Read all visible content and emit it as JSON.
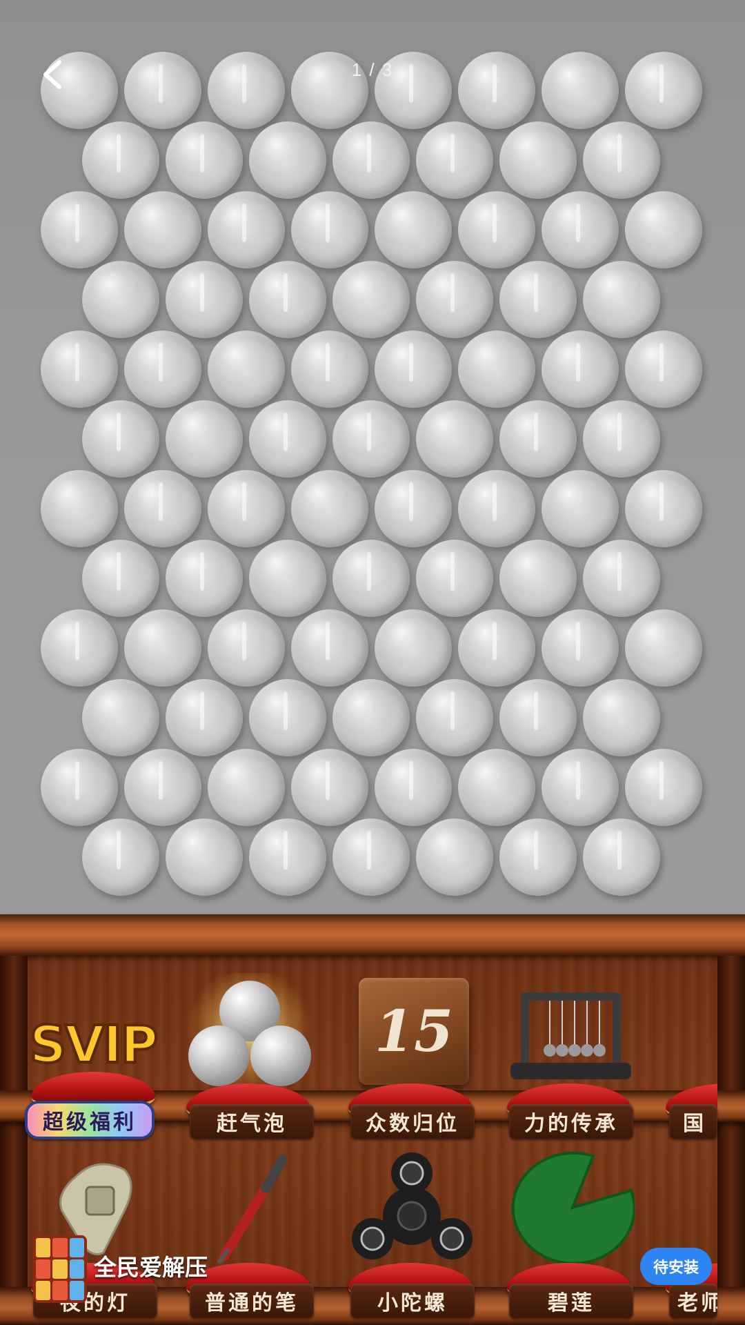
{
  "header": {
    "back_icon": "chevron-left-icon",
    "page_counter": "1 / 3"
  },
  "bubble_wrap": {
    "rows": 12,
    "bubbles_per_row_pattern": [
      8,
      7
    ],
    "bubble_color": "#c4c5c4"
  },
  "shelf": {
    "row1": [
      {
        "label": "超级福利",
        "icon": "svip-logo-icon",
        "logo_text": "SVIP"
      },
      {
        "label": "赶气泡",
        "icon": "bubbles-pyramid-icon"
      },
      {
        "label": "众数归位",
        "icon": "number-tile-icon",
        "tile_text": "15"
      },
      {
        "label": "力的传承",
        "icon": "newtons-cradle-icon"
      },
      {
        "label": "国",
        "icon": "partial-item-icon"
      }
    ],
    "row2": [
      {
        "label": "夜的灯",
        "icon": "light-switch-icon"
      },
      {
        "label": "普通的笔",
        "icon": "pen-icon"
      },
      {
        "label": "小陀螺",
        "icon": "fidget-spinner-icon"
      },
      {
        "label": "碧莲",
        "icon": "lotus-leaf-icon"
      },
      {
        "label": "老师",
        "icon": "partial-item-icon"
      }
    ]
  },
  "banner": {
    "app_name": "全民爱解压",
    "install_label": "待安装",
    "install_color": "#2d84f3"
  }
}
